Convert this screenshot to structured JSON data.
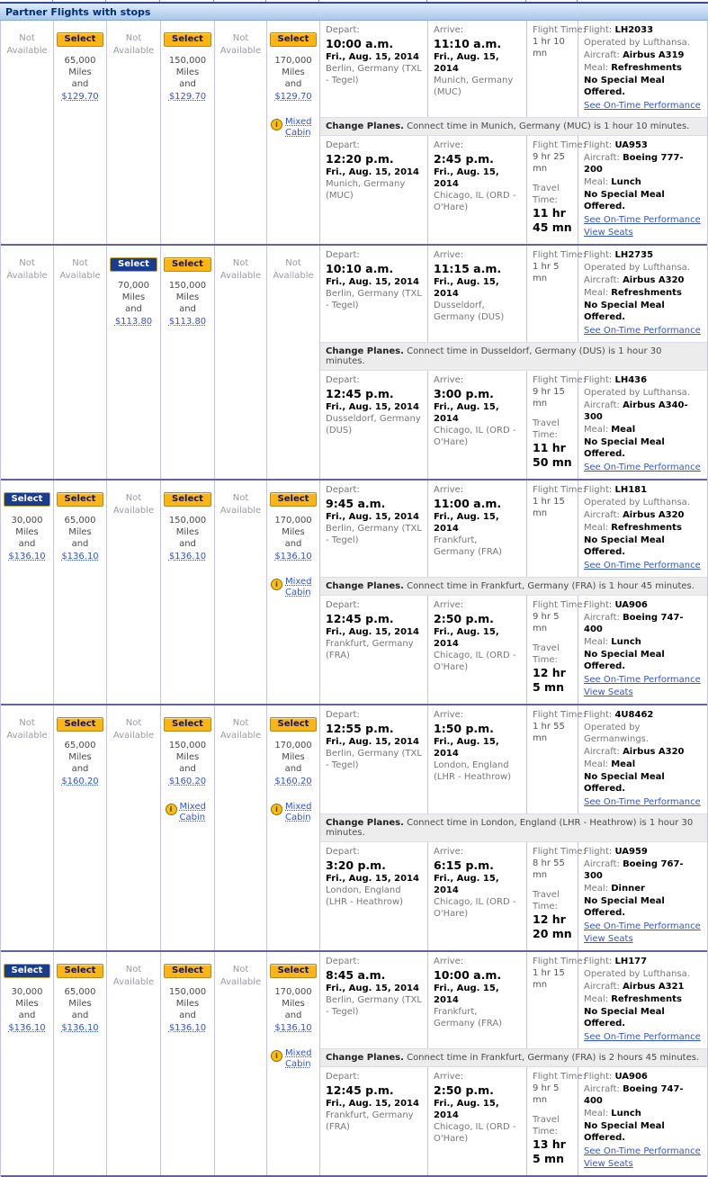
{
  "header": {
    "title": "Partner Flights with stops"
  },
  "labels": {
    "not_available": "Not Available",
    "select": "Select",
    "and": "and",
    "mixed_cabin": "Mixed Cabin",
    "info_icon": "i",
    "depart": "Depart:",
    "arrive": "Arrive:",
    "flight_time": "Flight Time:",
    "travel_time": "Travel Time:",
    "flight": "Flight:",
    "aircraft": "Aircraft:",
    "meal": "Meal:",
    "no_special_meal": "No Special Meal Offered.",
    "see_otp": "See On-Time Performance",
    "view_seats": "View Seats",
    "change_planes": "Change Planes."
  },
  "colors": {
    "accent_gold": "#fcb514",
    "accent_navy": "#1a3c8f",
    "link_blue": "#3355cc",
    "header_text": "#002e7a",
    "row_divider": "#62629e"
  },
  "rows": [
    {
      "awards": [
        {
          "available": false
        },
        {
          "available": true,
          "style": "yellow",
          "miles": "65,000 Miles",
          "price": "$129.70",
          "mixed_cabin": false
        },
        {
          "available": false
        },
        {
          "available": true,
          "style": "yellow",
          "miles": "150,000 Miles",
          "price": "$129.70",
          "mixed_cabin": false
        },
        {
          "available": false
        },
        {
          "available": true,
          "style": "yellow",
          "miles": "170,000 Miles",
          "price": "$129.70",
          "mixed_cabin": true
        }
      ],
      "segments": [
        {
          "depart_time": "10:00 a.m.",
          "depart_date": "Fri., Aug. 15, 2014",
          "depart_city": "Berlin, Germany (TXL - Tegel)",
          "arrive_time": "11:10 a.m.",
          "arrive_date": "Fri., Aug. 15, 2014",
          "arrive_city": "Munich, Germany (MUC)",
          "flight_time": "1 hr 10 mn",
          "travel_time": null,
          "flight_number": "LH2033",
          "operated_by": "Operated by Lufthansa.",
          "aircraft": "Airbus A319",
          "meal": "Refreshments",
          "no_special_meal": true,
          "see_otp": true,
          "view_seats": false
        },
        {
          "depart_time": "12:20 p.m.",
          "depart_date": "Fri., Aug. 15, 2014",
          "depart_city": "Munich, Germany (MUC)",
          "arrive_time": "2:45 p.m.",
          "arrive_date": "Fri., Aug. 15, 2014",
          "arrive_city": "Chicago, IL (ORD - O'Hare)",
          "flight_time": "9 hr 25 mn",
          "travel_time": "11 hr 45 mn",
          "flight_number": "UA953",
          "operated_by": null,
          "aircraft": "Boeing 777-200",
          "meal": "Lunch",
          "no_special_meal": true,
          "see_otp": true,
          "view_seats": true
        }
      ],
      "connection": "Connect time in Munich, Germany (MUC) is 1 hour 10 minutes."
    },
    {
      "awards": [
        {
          "available": false
        },
        {
          "available": false
        },
        {
          "available": true,
          "style": "blue",
          "miles": "70,000 Miles",
          "price": "$113.80",
          "mixed_cabin": false
        },
        {
          "available": true,
          "style": "yellow",
          "miles": "150,000 Miles",
          "price": "$113.80",
          "mixed_cabin": false
        },
        {
          "available": false
        },
        {
          "available": false
        }
      ],
      "segments": [
        {
          "depart_time": "10:10 a.m.",
          "depart_date": "Fri., Aug. 15, 2014",
          "depart_city": "Berlin, Germany (TXL - Tegel)",
          "arrive_time": "11:15 a.m.",
          "arrive_date": "Fri., Aug. 15, 2014",
          "arrive_city": "Dusseldorf, Germany (DUS)",
          "flight_time": "1 hr 5 mn",
          "travel_time": null,
          "flight_number": "LH2735",
          "operated_by": "Operated by Lufthansa.",
          "aircraft": "Airbus A320",
          "meal": "Refreshments",
          "no_special_meal": true,
          "see_otp": true,
          "view_seats": false
        },
        {
          "depart_time": "12:45 p.m.",
          "depart_date": "Fri., Aug. 15, 2014",
          "depart_city": "Dusseldorf, Germany (DUS)",
          "arrive_time": "3:00 p.m.",
          "arrive_date": "Fri., Aug. 15, 2014",
          "arrive_city": "Chicago, IL (ORD - O'Hare)",
          "flight_time": "9 hr 15 mn",
          "travel_time": "11 hr 50 mn",
          "flight_number": "LH436",
          "operated_by": "Operated by Lufthansa.",
          "aircraft": "Airbus A340-300",
          "meal": "Meal",
          "no_special_meal": true,
          "see_otp": true,
          "view_seats": false
        }
      ],
      "connection": "Connect time in Dusseldorf, Germany (DUS) is 1 hour 30 minutes."
    },
    {
      "awards": [
        {
          "available": true,
          "style": "blue",
          "miles": "30,000 Miles",
          "price": "$136.10",
          "mixed_cabin": false
        },
        {
          "available": true,
          "style": "yellow",
          "miles": "65,000 Miles",
          "price": "$136.10",
          "mixed_cabin": false
        },
        {
          "available": false
        },
        {
          "available": true,
          "style": "yellow",
          "miles": "150,000 Miles",
          "price": "$136.10",
          "mixed_cabin": false
        },
        {
          "available": false
        },
        {
          "available": true,
          "style": "yellow",
          "miles": "170,000 Miles",
          "price": "$136.10",
          "mixed_cabin": true
        }
      ],
      "segments": [
        {
          "depart_time": "9:45 a.m.",
          "depart_date": "Fri., Aug. 15, 2014",
          "depart_city": "Berlin, Germany (TXL - Tegel)",
          "arrive_time": "11:00 a.m.",
          "arrive_date": "Fri., Aug. 15, 2014",
          "arrive_city": "Frankfurt, Germany (FRA)",
          "flight_time": "1 hr 15 mn",
          "travel_time": null,
          "flight_number": "LH181",
          "operated_by": "Operated by Lufthansa.",
          "aircraft": "Airbus A320",
          "meal": "Refreshments",
          "no_special_meal": true,
          "see_otp": true,
          "view_seats": false
        },
        {
          "depart_time": "12:45 p.m.",
          "depart_date": "Fri., Aug. 15, 2014",
          "depart_city": "Frankfurt, Germany (FRA)",
          "arrive_time": "2:50 p.m.",
          "arrive_date": "Fri., Aug. 15, 2014",
          "arrive_city": "Chicago, IL (ORD - O'Hare)",
          "flight_time": "9 hr 5 mn",
          "travel_time": "12 hr 5 mn",
          "flight_number": "UA906",
          "operated_by": null,
          "aircraft": "Boeing 747-400",
          "meal": "Lunch",
          "no_special_meal": true,
          "see_otp": true,
          "view_seats": true
        }
      ],
      "connection": "Connect time in Frankfurt, Germany (FRA) is 1 hour 45 minutes."
    },
    {
      "awards": [
        {
          "available": false
        },
        {
          "available": true,
          "style": "yellow",
          "miles": "65,000 Miles",
          "price": "$160.20",
          "mixed_cabin": false
        },
        {
          "available": false
        },
        {
          "available": true,
          "style": "yellow",
          "miles": "150,000 Miles",
          "price": "$160.20",
          "mixed_cabin": true
        },
        {
          "available": false
        },
        {
          "available": true,
          "style": "yellow",
          "miles": "170,000 Miles",
          "price": "$160.20",
          "mixed_cabin": true
        }
      ],
      "segments": [
        {
          "depart_time": "12:55 p.m.",
          "depart_date": "Fri., Aug. 15, 2014",
          "depart_city": "Berlin, Germany (TXL - Tegel)",
          "arrive_time": "1:50 p.m.",
          "arrive_date": "Fri., Aug. 15, 2014",
          "arrive_city": "London, England (LHR - Heathrow)",
          "flight_time": "1 hr 55 mn",
          "travel_time": null,
          "flight_number": "4U8462",
          "operated_by": "Operated by Germanwings.",
          "aircraft": "Airbus A320",
          "meal": "Meal",
          "no_special_meal": true,
          "see_otp": true,
          "view_seats": false
        },
        {
          "depart_time": "3:20 p.m.",
          "depart_date": "Fri., Aug. 15, 2014",
          "depart_city": "London, England (LHR - Heathrow)",
          "arrive_time": "6:15 p.m.",
          "arrive_date": "Fri., Aug. 15, 2014",
          "arrive_city": "Chicago, IL (ORD - O'Hare)",
          "flight_time": "8 hr 55 mn",
          "travel_time": "12 hr 20 mn",
          "flight_number": "UA959",
          "operated_by": null,
          "aircraft": "Boeing 767-300",
          "meal": "Dinner",
          "no_special_meal": true,
          "see_otp": true,
          "view_seats": true
        }
      ],
      "connection": "Connect time in London, England (LHR - Heathrow) is 1 hour 30 minutes."
    },
    {
      "awards": [
        {
          "available": true,
          "style": "blue",
          "miles": "30,000 Miles",
          "price": "$136.10",
          "mixed_cabin": false
        },
        {
          "available": true,
          "style": "yellow",
          "miles": "65,000 Miles",
          "price": "$136.10",
          "mixed_cabin": false
        },
        {
          "available": false
        },
        {
          "available": true,
          "style": "yellow",
          "miles": "150,000 Miles",
          "price": "$136.10",
          "mixed_cabin": false
        },
        {
          "available": false
        },
        {
          "available": true,
          "style": "yellow",
          "miles": "170,000 Miles",
          "price": "$136.10",
          "mixed_cabin": true
        }
      ],
      "segments": [
        {
          "depart_time": "8:45 a.m.",
          "depart_date": "Fri., Aug. 15, 2014",
          "depart_city": "Berlin, Germany (TXL - Tegel)",
          "arrive_time": "10:00 a.m.",
          "arrive_date": "Fri., Aug. 15, 2014",
          "arrive_city": "Frankfurt, Germany (FRA)",
          "flight_time": "1 hr 15 mn",
          "travel_time": null,
          "flight_number": "LH177",
          "operated_by": "Operated by Lufthansa.",
          "aircraft": "Airbus A321",
          "meal": "Refreshments",
          "no_special_meal": true,
          "see_otp": true,
          "view_seats": false
        },
        {
          "depart_time": "12:45 p.m.",
          "depart_date": "Fri., Aug. 15, 2014",
          "depart_city": "Frankfurt, Germany (FRA)",
          "arrive_time": "2:50 p.m.",
          "arrive_date": "Fri., Aug. 15, 2014",
          "arrive_city": "Chicago, IL (ORD - O'Hare)",
          "flight_time": "9 hr 5 mn",
          "travel_time": "13 hr 5 mn",
          "flight_number": "UA906",
          "operated_by": null,
          "aircraft": "Boeing 747-400",
          "meal": "Lunch",
          "no_special_meal": true,
          "see_otp": true,
          "view_seats": true
        }
      ],
      "connection": "Connect time in Frankfurt, Germany (FRA) is 2 hours 45 minutes."
    }
  ]
}
